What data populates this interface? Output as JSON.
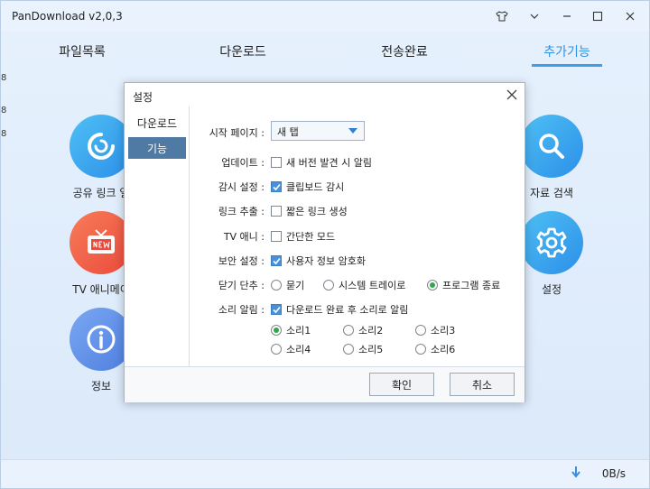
{
  "app": {
    "title": "PanDownload v2,0,3"
  },
  "tabs": [
    {
      "label": "파일목록"
    },
    {
      "label": "다운로드"
    },
    {
      "label": "전송완료"
    },
    {
      "label": "추가기능"
    }
  ],
  "left_strip": [
    "8",
    "8",
    "8"
  ],
  "features": {
    "share_link": "공유 링크 열",
    "search": "자료 검색",
    "tv": "TV 애니메이",
    "settings": "설정",
    "info": "정보"
  },
  "status": {
    "speed": "0B/s"
  },
  "dialog": {
    "title": "설정",
    "sidebar": [
      "다운로드",
      "기능"
    ],
    "rows": {
      "start_page": {
        "label": "시작 페이지 :",
        "value": "새 탭"
      },
      "update": {
        "label": "업데이트 :",
        "option": "새 버전 발견 시 알림",
        "checked": false
      },
      "monitor": {
        "label": "감시 설정 :",
        "option": "클립보드 감시",
        "checked": true
      },
      "link": {
        "label": "링크 추출 :",
        "option": "짧은 링크 생성",
        "checked": false
      },
      "tv": {
        "label": "TV 애니 :",
        "option": "간단한 모드",
        "checked": false
      },
      "security": {
        "label": "보안 설정 :",
        "option": "사용자 정보 암호화",
        "checked": true
      },
      "close_shortcut": {
        "label": "닫기 단추 :",
        "options": [
          "묻기",
          "시스템 트레이로",
          "프로그램 종료"
        ],
        "selected": 2
      },
      "sound": {
        "label": "소리 알림 :",
        "option": "다운로드 완료 후 소리로 알림",
        "checked": true,
        "sounds": [
          "소리1",
          "소리2",
          "소리3",
          "소리4",
          "소리5",
          "소리6"
        ],
        "selected": 0
      }
    },
    "buttons": {
      "ok": "확인",
      "cancel": "취소"
    }
  }
}
